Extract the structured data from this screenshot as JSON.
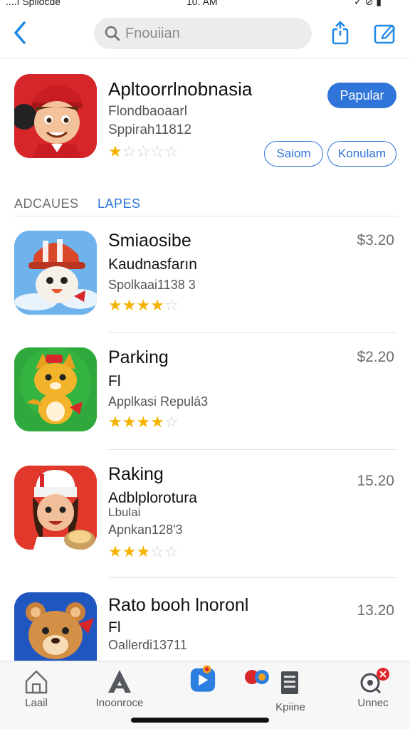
{
  "status_bar": {
    "left": "....ı Spllocde",
    "time": "10. AM",
    "right": "✓ ⊘ ▮"
  },
  "nav": {
    "back_icon": "chevron-left-icon",
    "search_placeholder": "Fnouiian",
    "share_icon": "share-icon",
    "edit_icon": "edit-icon"
  },
  "featured": {
    "title": "Apltoorrlnobnasia",
    "subtitle": "Flondbaoaarl",
    "meta": "Sppirah11812",
    "rating": 1,
    "rating_max": 5,
    "badge": "Papular",
    "buttons": [
      "Saiom",
      "Konulam"
    ]
  },
  "tabs": [
    {
      "label": "ADCAUES",
      "active": false
    },
    {
      "label": "LAPES",
      "active": true
    }
  ],
  "apps": [
    {
      "title": "Smiaosibe",
      "line2": "Kaudnasfarın",
      "line3": "Spolkaai1138 3",
      "rating": 4,
      "price": "$3.20"
    },
    {
      "title": "Parking",
      "line2": "Fl",
      "line3": "Applkasi Repulá3",
      "rating": 4,
      "price": "$2.20"
    },
    {
      "title": "Raking",
      "line2": "Adblplorotura",
      "line3": "Apnkan128'3",
      "line3_pre": "Lbulai",
      "rating": 3,
      "price": "15.20"
    },
    {
      "title": "Rato booh lnoronl",
      "line2": "Fl",
      "line3": "Oallerdi13711",
      "rating": 0,
      "price": "13.20"
    }
  ],
  "tabbar": [
    {
      "label": "Laail",
      "icon": "home-icon"
    },
    {
      "label": "Inoonroce",
      "icon": "arcade-icon"
    },
    {
      "label": "",
      "icon": "play-store-icon"
    },
    {
      "label": "Kpiine",
      "icon": "list-icon"
    },
    {
      "label": "Unnec",
      "icon": "account-icon"
    }
  ],
  "colors": {
    "accent": "#2f74d8",
    "star": "#f5b301"
  }
}
